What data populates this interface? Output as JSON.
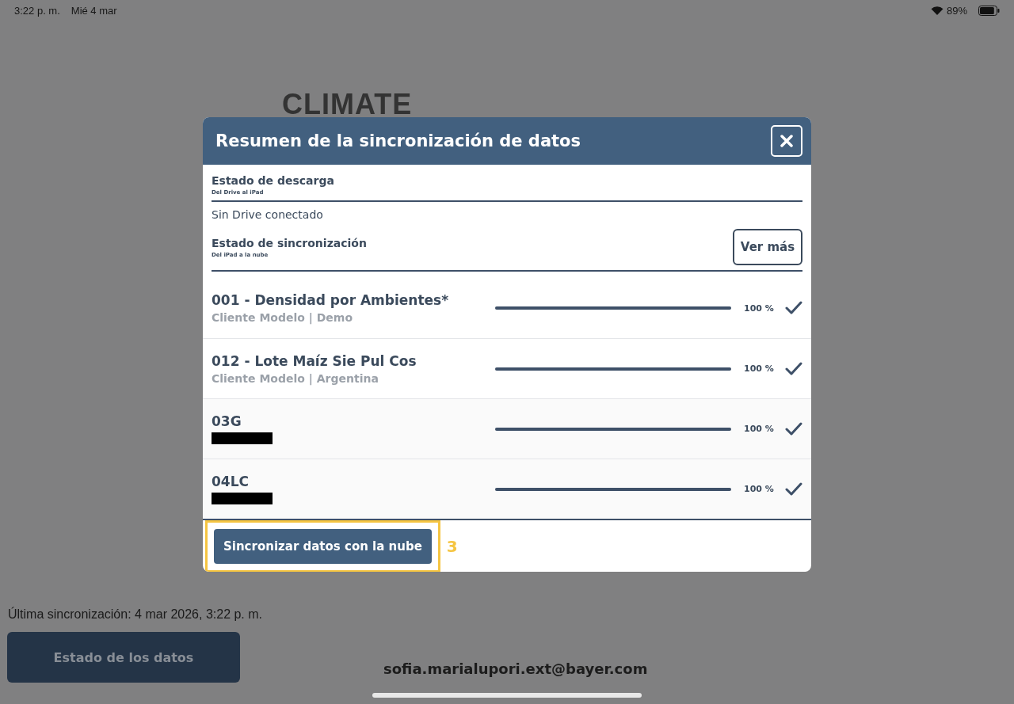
{
  "status_bar": {
    "time": "3:22 p. m.",
    "date": "Mié 4 mar",
    "battery": "89%"
  },
  "logo": "CLIMATE",
  "last_sync": "Última sincronización: 4 mar 2026, 3:22 p. m.",
  "data_status_button": "Estado de los datos",
  "account_email": "sofia.marialupori.ext@bayer.com",
  "dialog": {
    "title": "Resumen de la sincronización de datos",
    "download": {
      "title": "Estado de descarga",
      "subtitle": "Del Drive al iPad",
      "message": "Sin Drive conectado"
    },
    "sync": {
      "title": "Estado de sincronización",
      "subtitle": "Del iPad a la nube",
      "more_button": "Ver más"
    },
    "items": [
      {
        "name": "001 - Densidad por Ambientes*",
        "detail": "Cliente Modelo | Demo",
        "redacted": false,
        "level": 1,
        "reading": "100 %",
        "done": true
      },
      {
        "name": "012 - Lote Maíz Sie Pul Cos",
        "detail": "Cliente Modelo | Argentina",
        "redacted": false,
        "level": 1,
        "reading": "100 %",
        "done": true
      },
      {
        "name": "03G",
        "redacted": true,
        "level": 1,
        "reading": "100 %",
        "done": true
      },
      {
        "name": "04LC",
        "redacted": true,
        "level": 1,
        "reading": "100 %",
        "done": true
      }
    ],
    "sync_button": {
      "label": "Sincronizar datos con la nube",
      "highlighted": true,
      "step": "3"
    }
  }
}
